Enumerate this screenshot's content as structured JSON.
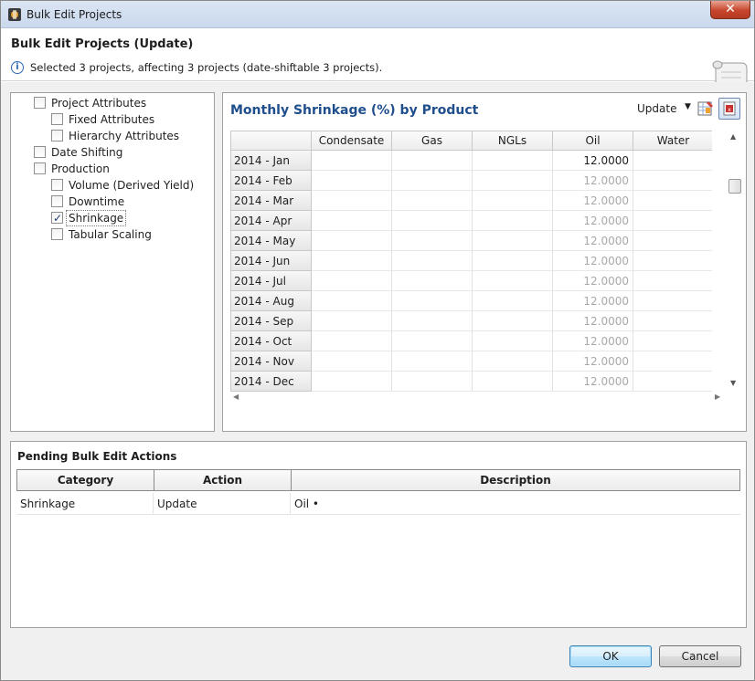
{
  "window": {
    "title": "Bulk Edit Projects",
    "close_glyph": "✕"
  },
  "header": {
    "title": "Bulk Edit Projects (Update)",
    "info_glyph": "i",
    "message": "Selected 3 projects, affecting 3 projects (date-shiftable 3 projects)."
  },
  "tree": {
    "items": [
      {
        "label": "Project Attributes",
        "checked": false,
        "level": 0
      },
      {
        "label": "Fixed Attributes",
        "checked": false,
        "level": 1
      },
      {
        "label": "Hierarchy Attributes",
        "checked": false,
        "level": 1
      },
      {
        "label": "Date Shifting",
        "checked": false,
        "level": 0
      },
      {
        "label": "Production",
        "checked": false,
        "level": 0
      },
      {
        "label": "Volume (Derived Yield)",
        "checked": false,
        "level": 1
      },
      {
        "label": "Downtime",
        "checked": false,
        "level": 1
      },
      {
        "label": "Shrinkage",
        "checked": true,
        "level": 1
      },
      {
        "label": "Tabular Scaling",
        "checked": false,
        "level": 1
      }
    ]
  },
  "editor": {
    "title": "Monthly Shrinkage (%) by Product",
    "mode_label": "Update",
    "mode_arrow": "▼",
    "columns": [
      "Condensate",
      "Gas",
      "NGLs",
      "Oil",
      "Water"
    ],
    "rows": [
      {
        "label": "2014 - Jan",
        "values": [
          "",
          "",
          "",
          "12.0000",
          ""
        ]
      },
      {
        "label": "2014 - Feb",
        "values": [
          "",
          "",
          "",
          "12.0000",
          ""
        ]
      },
      {
        "label": "2014 - Mar",
        "values": [
          "",
          "",
          "",
          "12.0000",
          ""
        ]
      },
      {
        "label": "2014 - Apr",
        "values": [
          "",
          "",
          "",
          "12.0000",
          ""
        ]
      },
      {
        "label": "2014 - May",
        "values": [
          "",
          "",
          "",
          "12.0000",
          ""
        ]
      },
      {
        "label": "2014 - Jun",
        "values": [
          "",
          "",
          "",
          "12.0000",
          ""
        ]
      },
      {
        "label": "2014 - Jul",
        "values": [
          "",
          "",
          "",
          "12.0000",
          ""
        ]
      },
      {
        "label": "2014 - Aug",
        "values": [
          "",
          "",
          "",
          "12.0000",
          ""
        ]
      },
      {
        "label": "2014 - Sep",
        "values": [
          "",
          "",
          "",
          "12.0000",
          ""
        ]
      },
      {
        "label": "2014 - Oct",
        "values": [
          "",
          "",
          "",
          "12.0000",
          ""
        ]
      },
      {
        "label": "2014 - Nov",
        "values": [
          "",
          "",
          "",
          "12.0000",
          ""
        ]
      },
      {
        "label": "2014 - Dec",
        "values": [
          "",
          "",
          "",
          "12.0000",
          ""
        ]
      }
    ],
    "scroll_up": "▲",
    "scroll_down": "▼",
    "scroll_left": "◀",
    "scroll_right": "▶"
  },
  "pending": {
    "title": "Pending Bulk Edit Actions",
    "columns": [
      "Category",
      "Action",
      "Description"
    ],
    "rows": [
      {
        "category": "Shrinkage",
        "action": "Update",
        "description": "Oil •"
      }
    ]
  },
  "buttons": {
    "ok": "OK",
    "cancel": "Cancel"
  },
  "colors": {
    "title_blue": "#1f4e8c",
    "dim_value": "#a9a9a9",
    "ok_border": "#3c7fb1"
  }
}
